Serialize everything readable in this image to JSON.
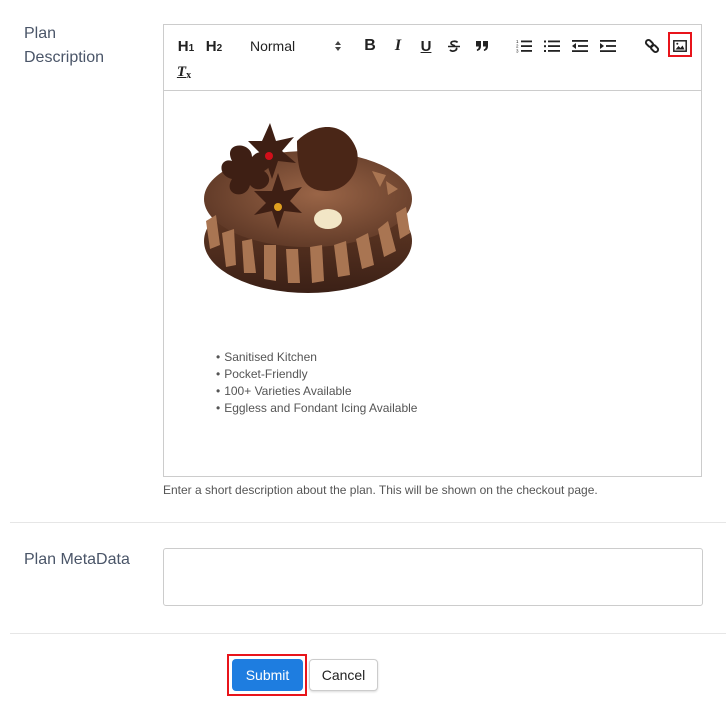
{
  "fields": {
    "description": {
      "label_line1": "Plan",
      "label_line2": "Description",
      "help_text": "Enter a short description about the plan. This will be shown on the checkout page.",
      "bullets": [
        "Sanitised Kitchen",
        "Pocket-Friendly",
        "100+ Varieties Available",
        "Eggless and Fondant Icing Available"
      ],
      "image_alt": "chocolate cake"
    },
    "metadata": {
      "label": "Plan MetaData",
      "value": ""
    }
  },
  "toolbar": {
    "h1": "H",
    "h1_sub": "1",
    "h2": "H",
    "h2_sub": "2",
    "format_select": "Normal",
    "bold": "B",
    "italic": "I",
    "underline": "U",
    "clear_format": "T",
    "clear_format_sub": "x",
    "highlight_color": "#e8141b"
  },
  "actions": {
    "submit_label": "Submit",
    "cancel_label": "Cancel",
    "primary_color": "#1e7de0"
  }
}
